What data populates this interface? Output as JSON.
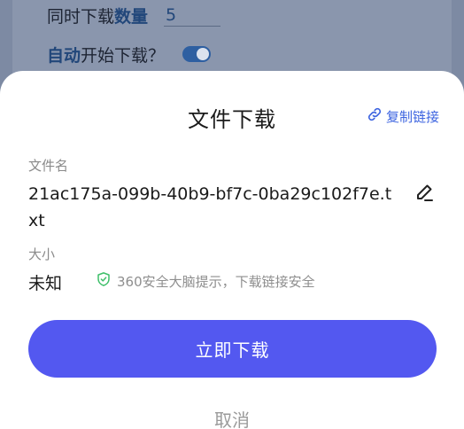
{
  "background": {
    "concurrent_label": "同时下载",
    "concurrent_label_bold": "数量",
    "concurrent_value": "5",
    "auto_label_bold": "自动",
    "auto_label": "开始下载？",
    "auto_toggle_on": true
  },
  "dialog": {
    "title": "文件下载",
    "copy_link_label": "复制链接",
    "filename_label": "文件名",
    "filename": "21ac175a-099b-40b9-bf7c-0ba29c102f7e.txt",
    "size_label": "大小",
    "size_value": "未知",
    "safety_text": "360安全大脑提示，下载链接安全",
    "download_button": "立即下载",
    "cancel_button": "取消"
  },
  "icons": {
    "copy_link": "link-icon",
    "edit": "edit-icon",
    "shield": "shield-check-icon"
  },
  "colors": {
    "primary": "#5358f0",
    "link": "#3d64e0",
    "safe": "#3fbf6a"
  }
}
